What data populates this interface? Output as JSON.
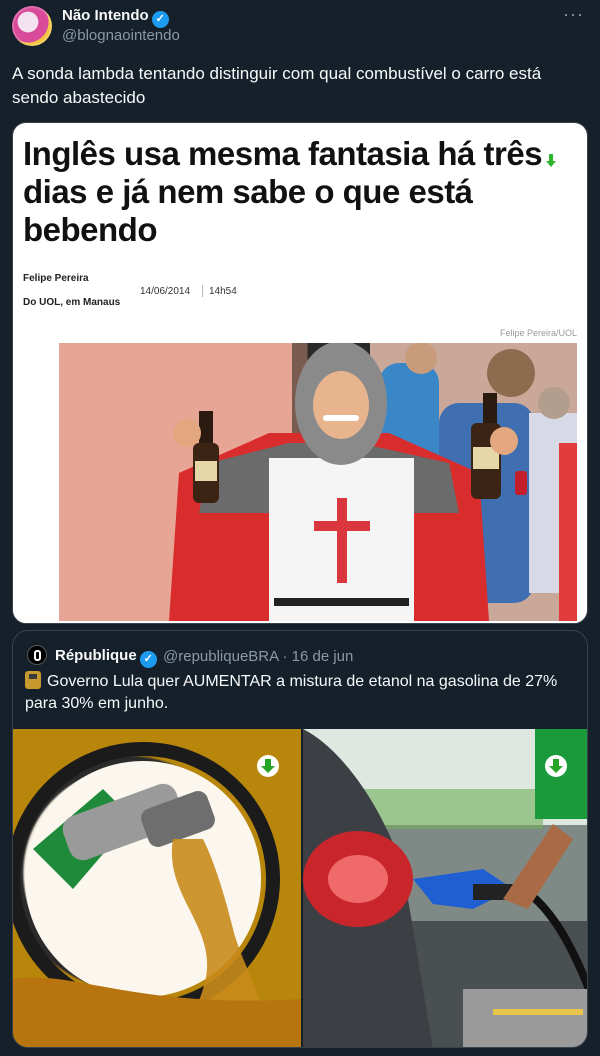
{
  "author": {
    "name": "Não Intendo",
    "handle": "@blognaointendo"
  },
  "menu_glyph": "···",
  "tweet": {
    "text": "A sonda lambda tentando distinguir com qual combustível o carro está sendo abastecido"
  },
  "article_image": {
    "headline": "Inglês usa mesma fantasia há três dias e já nem sabe o que está bebendo",
    "author": "Felipe Pereira",
    "place": "Do UOL, em Manaus",
    "date": "14/06/2014",
    "time": "14h54",
    "photo_credit": "Felipe Pereira/UOL"
  },
  "quoted_tweet": {
    "name": "République",
    "meta": "@republiqueBRA · 16 de jun",
    "text": "Governo Lula quer AUMENTAR a mistura de etanol na gasolina de 27% para 30% em junho."
  },
  "icons": {
    "verified": "verified-badge-icon",
    "download": "download-arrow-icon",
    "fuel": "fuel-pump-icon"
  },
  "colors": {
    "background": "#15202b",
    "text": "#f7f9f9",
    "muted": "#8b98a5",
    "border": "#38444d",
    "verified": "#1d9bf0"
  }
}
